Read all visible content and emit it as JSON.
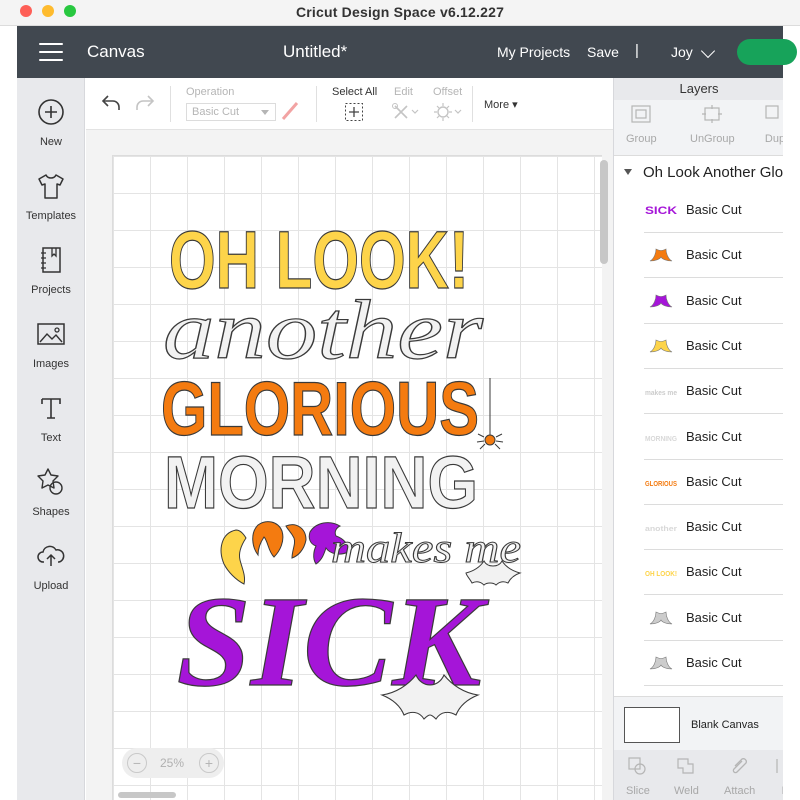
{
  "window": {
    "title": "Cricut Design Space  v6.12.227"
  },
  "header": {
    "section": "Canvas",
    "document_title": "Untitled*",
    "my_projects": "My Projects",
    "save": "Save",
    "separator": "|",
    "user": "Joy"
  },
  "sidebar": {
    "items": [
      {
        "label": "New",
        "icon": "plus-circle-icon"
      },
      {
        "label": "Templates",
        "icon": "tshirt-icon"
      },
      {
        "label": "Projects",
        "icon": "notebook-icon"
      },
      {
        "label": "Images",
        "icon": "image-icon"
      },
      {
        "label": "Text",
        "icon": "text-icon"
      },
      {
        "label": "Shapes",
        "icon": "shapes-icon"
      },
      {
        "label": "Upload",
        "icon": "cloud-upload-icon"
      }
    ]
  },
  "toolbar": {
    "operation_label": "Operation",
    "operation_value": "Basic Cut",
    "select_all": "Select All",
    "edit": "Edit",
    "offset": "Offset",
    "more": "More"
  },
  "canvas": {
    "zoom": "25%",
    "zoom_minus": "−",
    "zoom_plus": "+",
    "design_lines": [
      "OH LOOK!",
      "another",
      "GLORIOUS",
      "MORNING",
      "makes me",
      "SICK"
    ],
    "colors": {
      "yellow": "#fdd44a",
      "white": "#f2f2f2",
      "orange": "#f47b10",
      "purple": "#a515d8",
      "outline": "#3a3a3a"
    }
  },
  "layers": {
    "tab": "Layers",
    "actions": [
      "Group",
      "UnGroup",
      "Dup"
    ],
    "group_name": "Oh Look Another Glo",
    "items": [
      {
        "label": "Basic Cut",
        "thumb_text": "SICK",
        "color": "#a515d8"
      },
      {
        "label": "Basic Cut",
        "thumb_text": "",
        "color": "#f47b10"
      },
      {
        "label": "Basic Cut",
        "thumb_text": "",
        "color": "#a515d8"
      },
      {
        "label": "Basic Cut",
        "thumb_text": "",
        "color": "#fdd44a"
      },
      {
        "label": "Basic Cut",
        "thumb_text": "makes me",
        "color": "#cccccc"
      },
      {
        "label": "Basic Cut",
        "thumb_text": "MORNING",
        "color": "#d8d8d8"
      },
      {
        "label": "Basic Cut",
        "thumb_text": "GLORIOUS",
        "color": "#f47b10"
      },
      {
        "label": "Basic Cut",
        "thumb_text": "another",
        "color": "#d8d8d8"
      },
      {
        "label": "Basic Cut",
        "thumb_text": "OH LOOK!",
        "color": "#fdd44a"
      },
      {
        "label": "Basic Cut",
        "thumb_text": "",
        "color": "#cccccc"
      },
      {
        "label": "Basic Cut",
        "thumb_text": "",
        "color": "#cccccc"
      }
    ],
    "blank_canvas": "Blank Canvas",
    "bottom_actions": [
      "Slice",
      "Weld",
      "Attach",
      "F"
    ]
  }
}
